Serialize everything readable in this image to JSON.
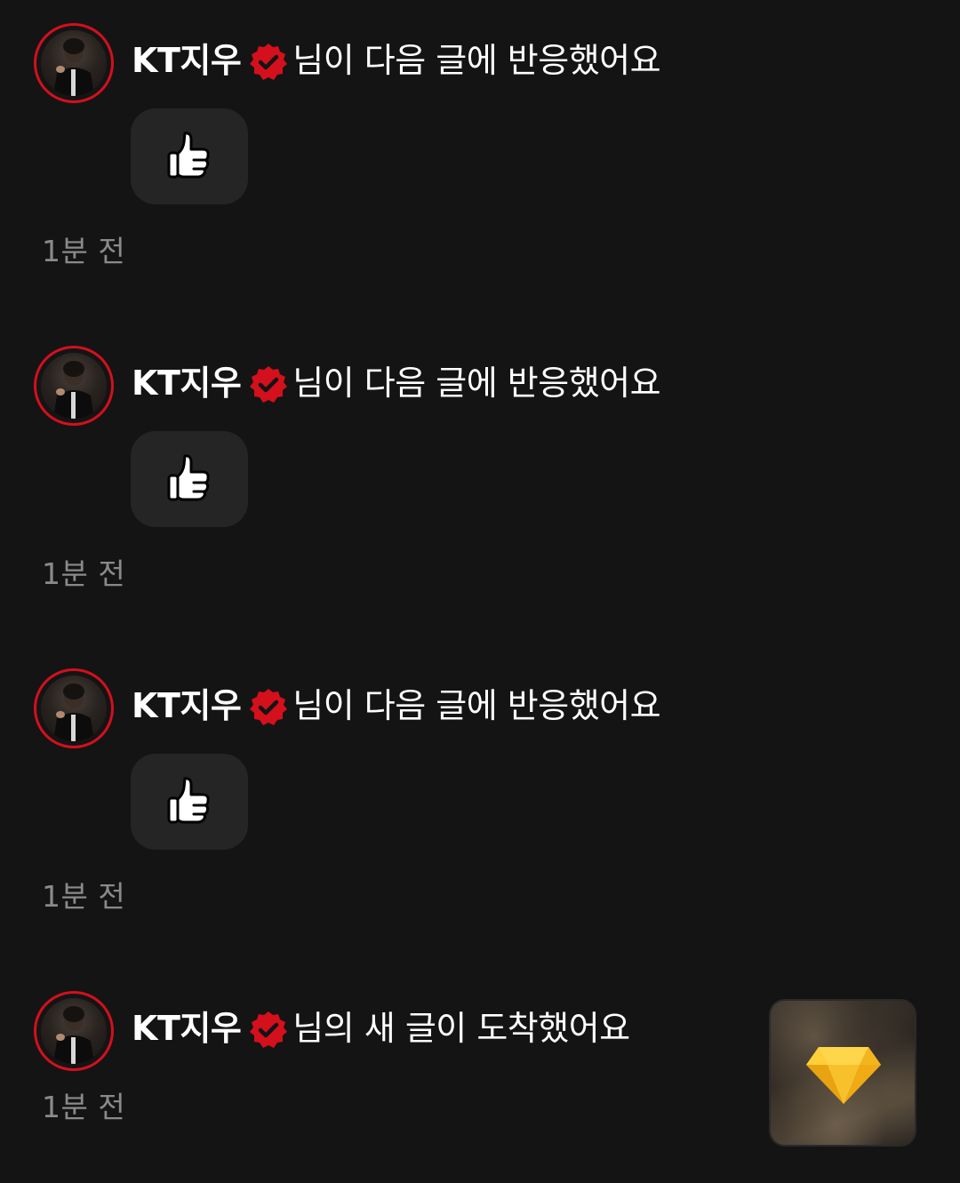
{
  "notifications": [
    {
      "name": "KT지우",
      "message": "님이 다음 글에 반응했어요",
      "reaction_icon": "thumbs-up-icon",
      "time": "1분 전"
    },
    {
      "name": "KT지우",
      "message": "님이 다음 글에 반응했어요",
      "reaction_icon": "thumbs-up-icon",
      "time": "1분 전"
    },
    {
      "name": "KT지우",
      "message": "님이 다음 글에 반응했어요",
      "reaction_icon": "thumbs-up-icon",
      "time": "1분 전"
    },
    {
      "name": "KT지우",
      "message": "님의 새 글이 도착했어요",
      "thumbnail_icon": "gem-icon",
      "time": "1분 전"
    }
  ],
  "colors": {
    "background": "#141415",
    "accent_red": "#d3101c",
    "reaction_bubble": "#252526",
    "time_text": "#8a8a8c",
    "gem_yellow": "#f5b820"
  }
}
